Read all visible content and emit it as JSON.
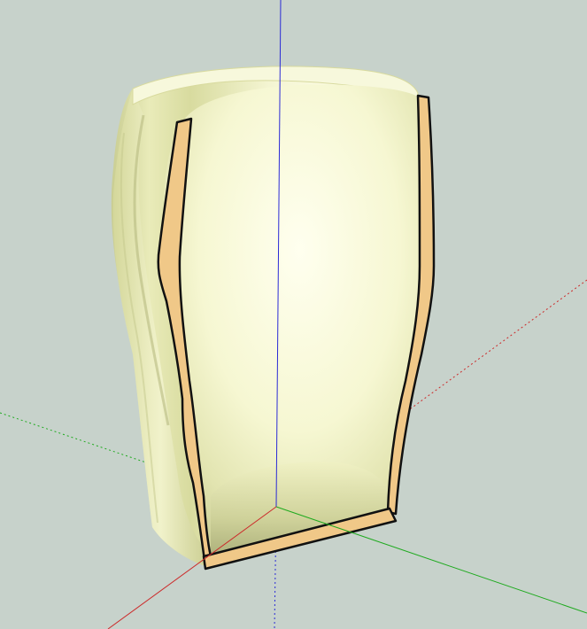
{
  "viewport": {
    "background": "#c7d2cb",
    "model": "vase-section-cut",
    "axes": {
      "blue": "#2a2ad6",
      "red": "#cc2a2a",
      "green": "#1faa1f"
    },
    "colors": {
      "surface_light": "#fdfde6",
      "surface_mid": "#eef0c2",
      "surface_dark": "#c8cc94",
      "section_fill": "#f0c888",
      "section_edge": "#111111"
    }
  }
}
